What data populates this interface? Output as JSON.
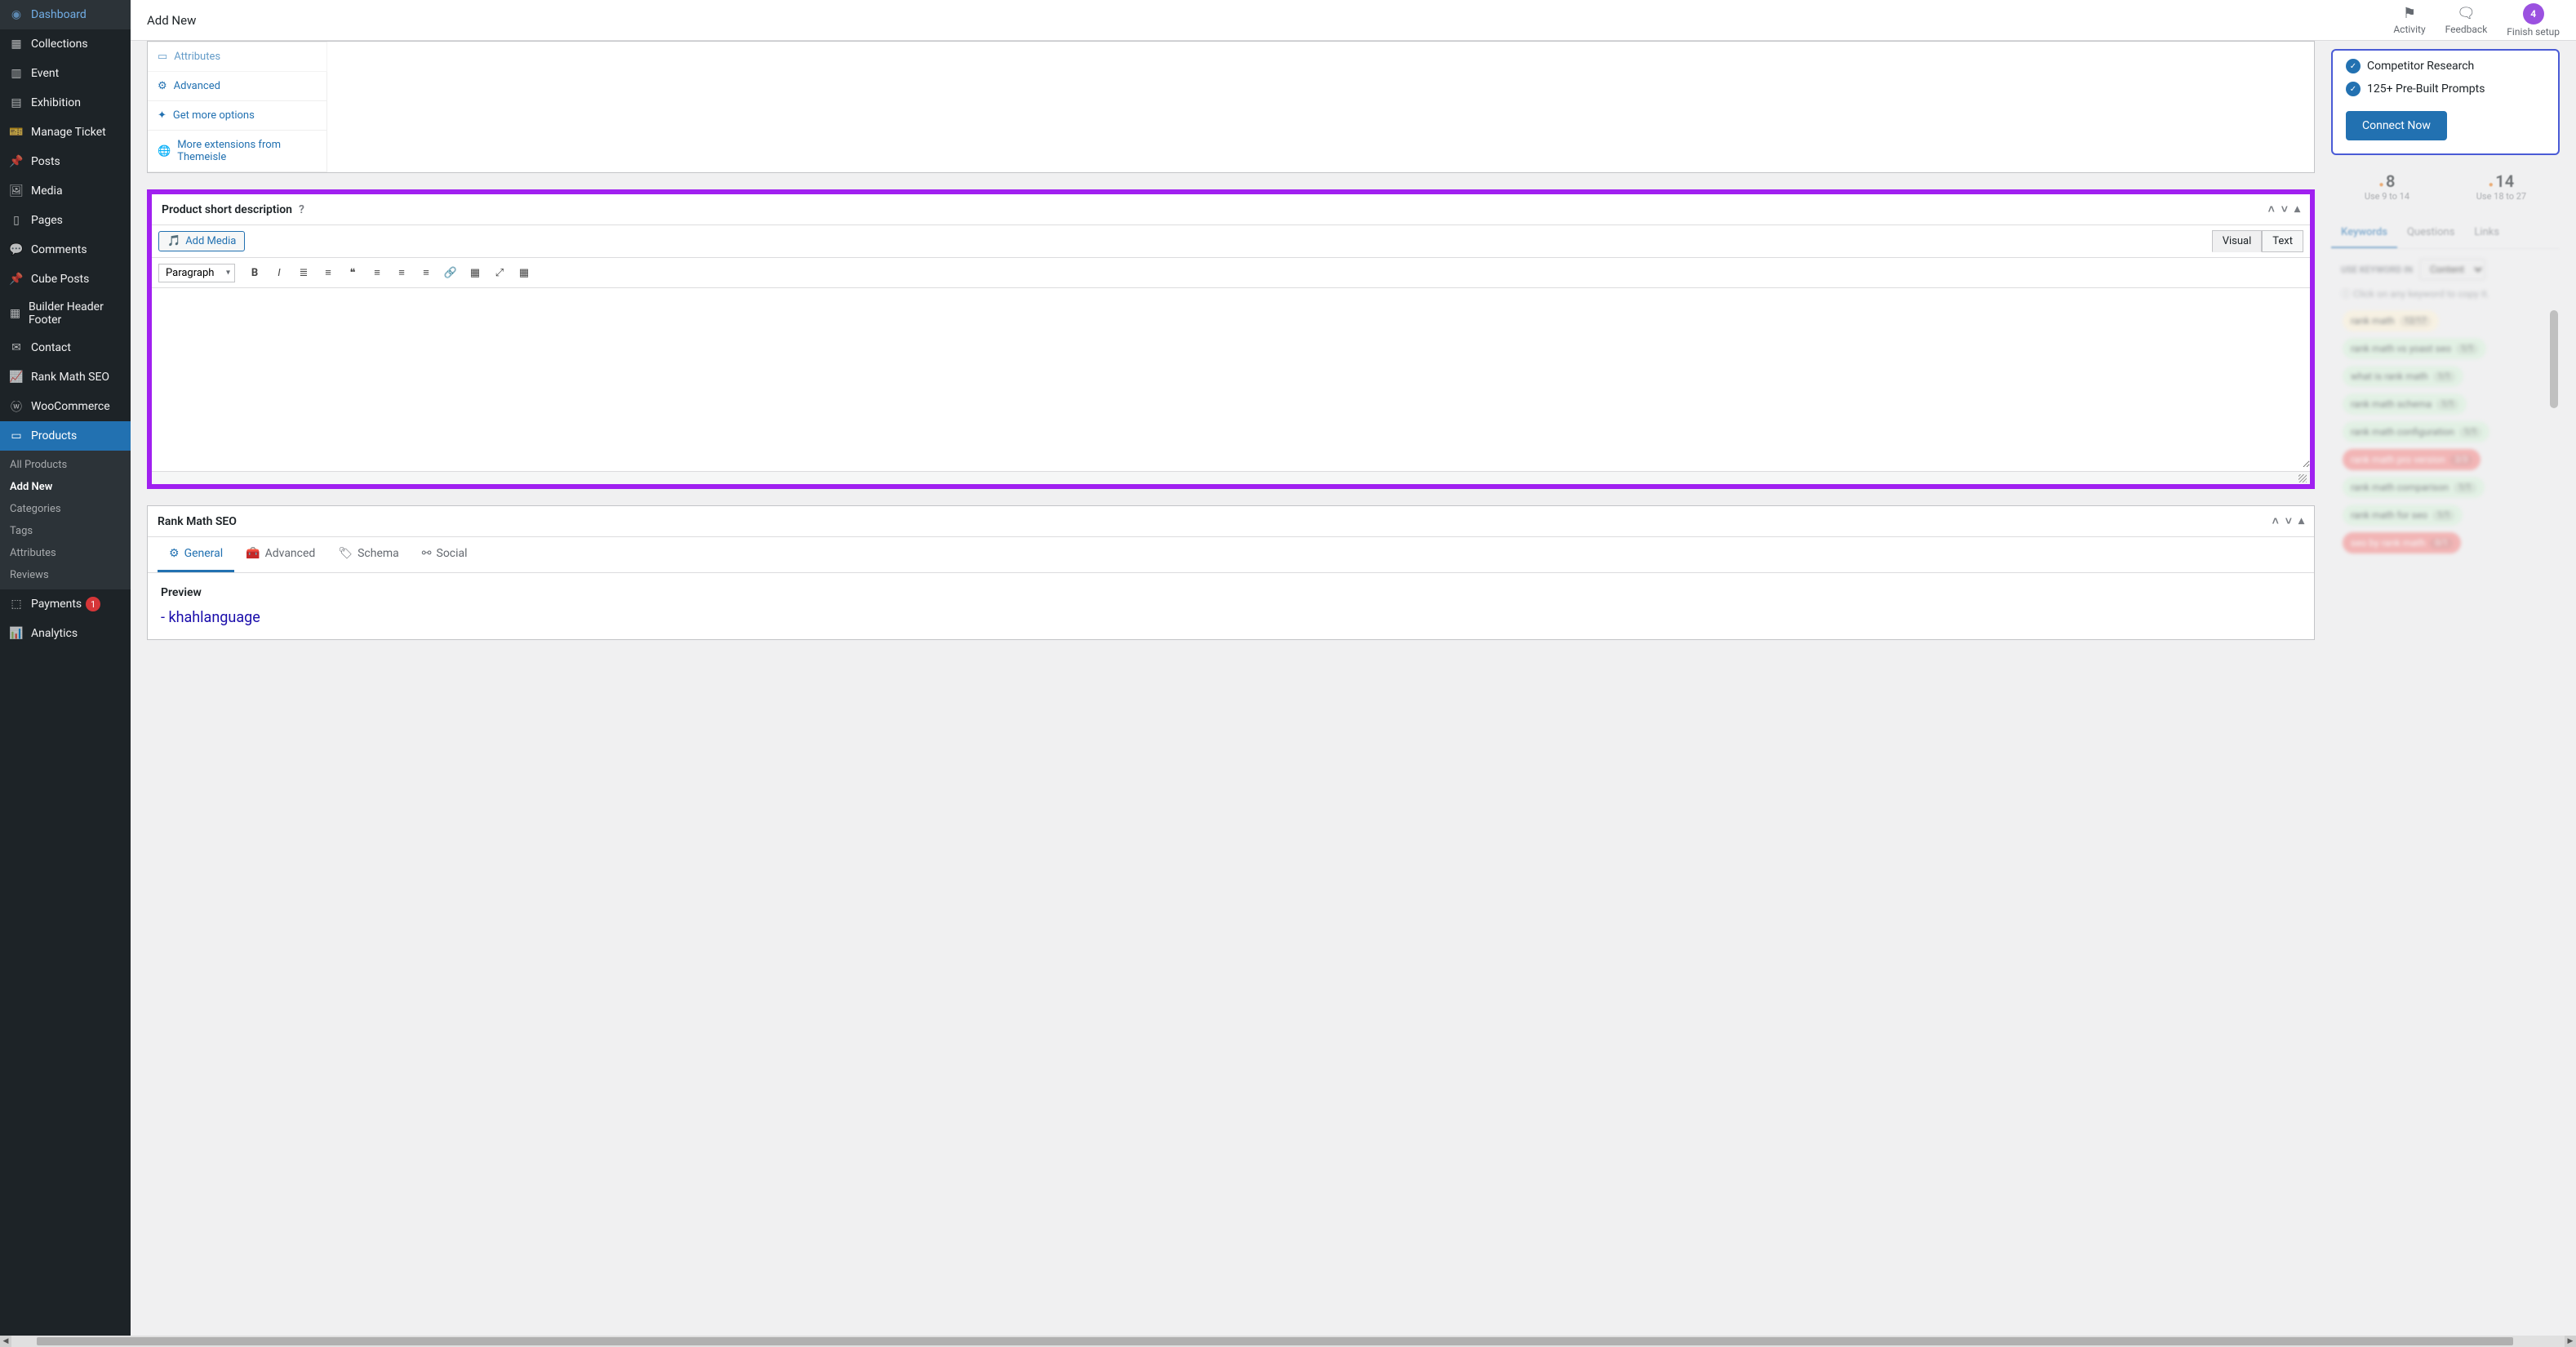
{
  "topbar": {
    "title": "Add New",
    "activity": "Activity",
    "feedback": "Feedback",
    "finish_setup": "Finish setup",
    "finish_badge": "4"
  },
  "sidebar": {
    "items": [
      {
        "icon": "dashboard",
        "label": "Dashboard"
      },
      {
        "icon": "collections",
        "label": "Collections"
      },
      {
        "icon": "event",
        "label": "Event"
      },
      {
        "icon": "exhibition",
        "label": "Exhibition"
      },
      {
        "icon": "ticket",
        "label": "Manage Ticket"
      },
      {
        "icon": "posts",
        "label": "Posts"
      },
      {
        "icon": "media",
        "label": "Media"
      },
      {
        "icon": "pages",
        "label": "Pages"
      },
      {
        "icon": "comments",
        "label": "Comments"
      },
      {
        "icon": "cubeposts",
        "label": "Cube Posts"
      },
      {
        "icon": "builder",
        "label": "Builder Header Footer"
      },
      {
        "icon": "contact",
        "label": "Contact"
      },
      {
        "icon": "rankmath",
        "label": "Rank Math SEO"
      },
      {
        "icon": "woo",
        "label": "WooCommerce"
      },
      {
        "icon": "products",
        "label": "Products",
        "active": true
      },
      {
        "icon": "payments",
        "label": "Payments",
        "badge": "1"
      },
      {
        "icon": "analytics",
        "label": "Analytics"
      }
    ],
    "sub_products": [
      {
        "label": "All Products"
      },
      {
        "label": "Add New",
        "current": true
      },
      {
        "label": "Categories"
      },
      {
        "label": "Tags"
      },
      {
        "label": "Attributes"
      },
      {
        "label": "Reviews"
      }
    ]
  },
  "product_data": {
    "side_items": [
      {
        "icon": "attributes",
        "label": "Attributes"
      },
      {
        "icon": "advanced",
        "label": "Advanced"
      },
      {
        "icon": "getmore",
        "label": "Get more options"
      },
      {
        "icon": "extensions",
        "label": "More extensions from Themeisle"
      }
    ]
  },
  "short_desc": {
    "title": "Product short description",
    "add_media": "Add Media",
    "visual_tab": "Visual",
    "text_tab": "Text",
    "format_select": "Paragraph"
  },
  "seo_panel": {
    "title": "Rank Math SEO",
    "tabs": {
      "general": "General",
      "advanced": "Advanced",
      "schema": "Schema",
      "social": "Social"
    },
    "preview_label": "Preview",
    "preview_link": "- khahlanguage"
  },
  "right": {
    "ai_features": [
      "Competitor Research",
      "125+ Pre-Built Prompts"
    ],
    "connect": "Connect Now",
    "stats": [
      {
        "num": "8",
        "sub": "Use 9 to 14"
      },
      {
        "num": "14",
        "sub": "Use 18 to 27"
      }
    ],
    "kw_tabs": [
      "Keywords",
      "Questions",
      "Links"
    ],
    "use_kw_label": "USE KEYWORD IN",
    "kw_select": "Content",
    "kw_hint": "Click on any keyword to copy it.",
    "keywords": [
      {
        "text": "rank math",
        "count": "12/17",
        "color": "yellow"
      },
      {
        "text": "rank math vs yoast seo",
        "count": "1/1",
        "color": "green"
      },
      {
        "text": "what is rank math",
        "count": "1/1",
        "color": "green"
      },
      {
        "text": "rank math schema",
        "count": "1/1",
        "color": "green"
      },
      {
        "text": "rank math configuration",
        "count": "1/1",
        "color": "green"
      },
      {
        "text": "rank math pro version",
        "count": "2/3",
        "color": "red"
      },
      {
        "text": "rank math comparison",
        "count": "1/1",
        "color": "green"
      },
      {
        "text": "rank math for seo",
        "count": "1/1",
        "color": "green"
      },
      {
        "text": "seo by rank math",
        "count": "0/1",
        "color": "red"
      }
    ]
  }
}
